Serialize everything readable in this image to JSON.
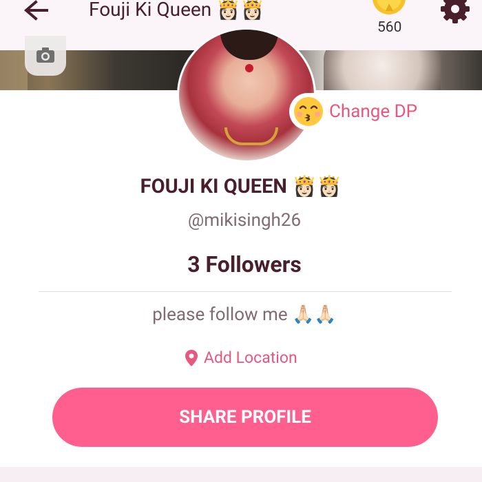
{
  "header": {
    "title": "Fouji Ki Queen 👸🏻👸🏻",
    "coins": "560"
  },
  "profile": {
    "change_dp_label": "Change DP",
    "change_dp_emoji": "😚",
    "name": "FOUJI KI QUEEN 👸🏻👸🏻",
    "handle": "@mikisingh26",
    "followers": "3 Followers",
    "bio": "please follow me 🙏🏻🙏🏻",
    "location_label": "Add Location"
  },
  "actions": {
    "share_label": "SHARE PROFILE"
  },
  "icons": {
    "back": "back-arrow-icon",
    "coin": "coin-star-icon",
    "settings": "gear-icon",
    "camera": "camera-icon",
    "location": "location-pin-icon"
  },
  "colors": {
    "accent": "#fe5f8f",
    "link": "#e8577d",
    "heading": "#4a1f2c",
    "secondary_text": "#826a73",
    "topbar_bg": "#fbf5fa"
  }
}
